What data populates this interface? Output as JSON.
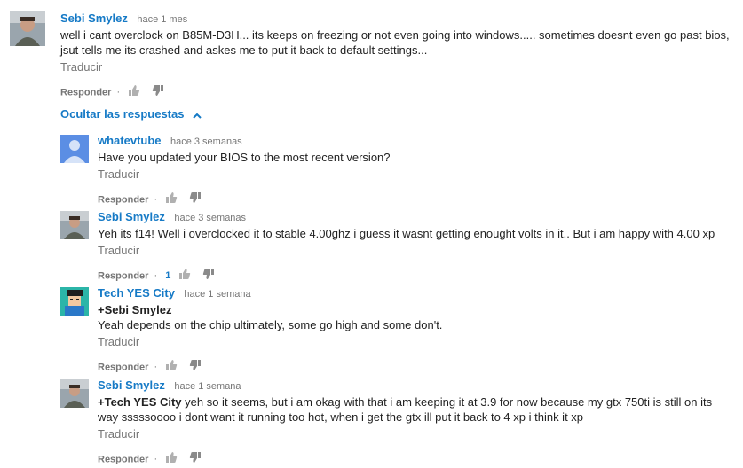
{
  "main_comment": {
    "author": "Sebi Smylez",
    "time": "hace 1 mes",
    "text": "well i cant overclock on  B85M-D3H... its keeps on freezing or not even going into windows..... sometimes doesnt even go past bios, jsut tells me its crashed and askes me to put it back to default settings...",
    "translate": "Traducir",
    "reply": "Responder"
  },
  "hide_replies": "Ocultar las respuestas",
  "replies": [
    {
      "author": "whatevtube",
      "time": "hace 3 semanas",
      "text": "Have you updated your BIOS to the most recent version?",
      "translate": "Traducir",
      "reply": "Responder"
    },
    {
      "author": "Sebi Smylez",
      "time": "hace 3 semanas",
      "text": "Yeh its f14! Well i overclocked it to stable 4.00ghz i guess it wasnt getting enought volts in it.. But i am happy with 4.00 xp",
      "translate": "Traducir",
      "reply": "Responder",
      "likes": "1"
    },
    {
      "author": "Tech YES City",
      "time": "hace 1 semana",
      "mention": "+Sebi Smylez",
      "text": "Yeah depends on the chip ultimately, some go high and some don't.",
      "translate": "Traducir",
      "reply": "Responder"
    },
    {
      "author": "Sebi Smylez",
      "time": "hace 1 semana",
      "mention": "+Tech YES City",
      "text": " yeh so it seems, but i am okag with that i am keeping it at 3.9 for now because my gtx 750ti is still on its way sssssoooo i dont want it running too hot, when i get the gtx ill put it back to 4 xp i think it xp",
      "translate": "Traducir",
      "reply": "Responder"
    }
  ],
  "colors": {
    "link": "#167ac6",
    "meta": "#767676",
    "text": "#222222"
  },
  "icons": [
    "thumbs-up-icon",
    "thumbs-down-icon",
    "chevron-up-icon"
  ]
}
